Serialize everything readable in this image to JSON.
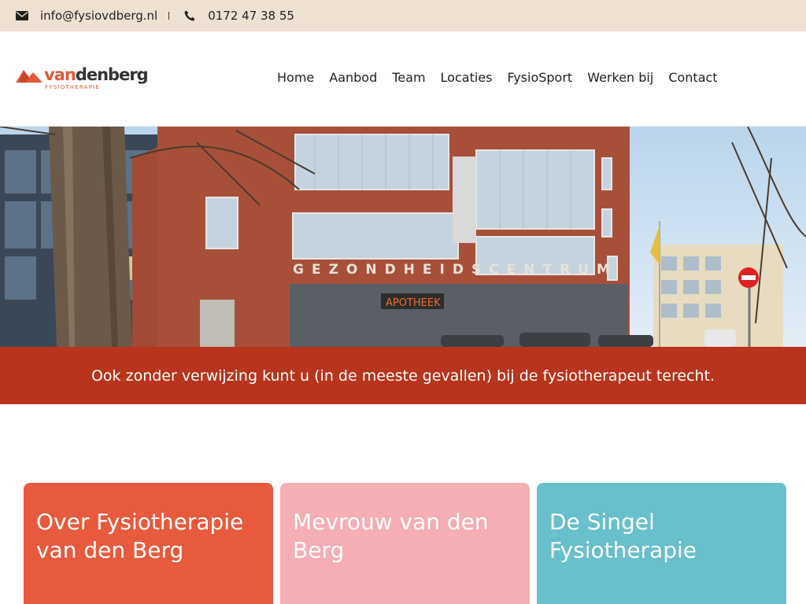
{
  "topbar": {
    "email": "info@fysiovdberg.nl",
    "email_icon": "envelope-icon",
    "phone": "0172 47 38 55",
    "phone_icon": "phone-icon",
    "background": "#efe1d2"
  },
  "logo": {
    "name_part1": "van",
    "name_part2": "den",
    "name_part3": "berg",
    "tagline": "FYSIOTHERAPIE",
    "accent_color": "#e25a3b"
  },
  "nav": {
    "items": [
      "Home",
      "Aanbod",
      "Team",
      "Locaties",
      "FysioSport",
      "Werken bij",
      "Contact"
    ]
  },
  "hero": {
    "building_sign": "GEZONDHEIDSCENTRUM",
    "shop_sign": "APOTHEEK"
  },
  "banner": {
    "text": "Ook zonder verwijzing kunt u (in de meeste gevallen) bij de fysiotherapeut terecht.",
    "color": "#b8341d"
  },
  "cards": [
    {
      "title": "Over Fysiotherapie van den Berg",
      "color": "#e85a3e"
    },
    {
      "title": "Mevrouw van den Berg",
      "color": "#f5aeb3"
    },
    {
      "title": "De Singel Fysiotherapie",
      "color": "#67c0cb"
    }
  ]
}
